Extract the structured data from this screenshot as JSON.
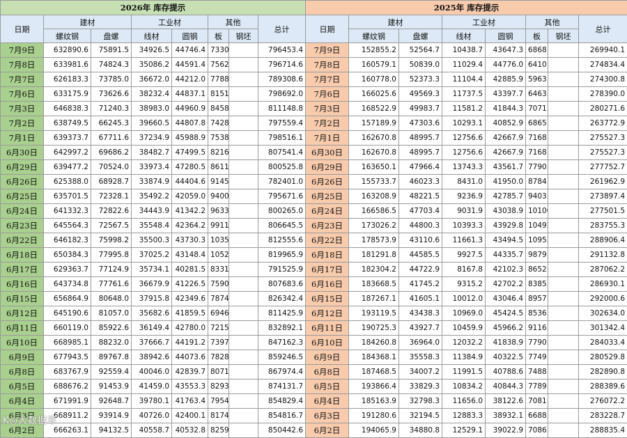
{
  "left": {
    "title": "2026年 库存提示",
    "headers": {
      "date": "日期",
      "jiancai": "建材",
      "gongyecai": "工业材",
      "qita": "其他",
      "total": "总计",
      "subs": [
        "螺纹钢",
        "盘螺",
        "线材",
        "圆钢",
        "板",
        "钢坯"
      ]
    },
    "rows": [
      [
        "7月9日",
        "632890.6",
        "75891.5",
        "34926.5",
        "44746.4",
        "7330.2",
        "",
        "796453.4"
      ],
      [
        "7月8日",
        "633981.6",
        "74824.3",
        "35086.2",
        "44591.4",
        "7562.8",
        "",
        "796714.6"
      ],
      [
        "7月7日",
        "626183.3",
        "73785.0",
        "36672.0",
        "44212.0",
        "7788.1",
        "",
        "789308.6"
      ],
      [
        "7月6日",
        "633175.9",
        "73626.6",
        "38232.4",
        "44837.1",
        "8151.7",
        "",
        "798692.0"
      ],
      [
        "7月3日",
        "646838.3",
        "71240.3",
        "38983.0",
        "44960.9",
        "8458.1",
        "",
        "811148.8"
      ],
      [
        "7月2日",
        "638749.5",
        "66245.3",
        "39660.5",
        "44807.8",
        "7428.0",
        "",
        "797559.4"
      ],
      [
        "7月1日",
        "639373.7",
        "67711.6",
        "37234.9",
        "45988.9",
        "7538.8",
        "",
        "798516.1"
      ],
      [
        "6月30日",
        "642997.2",
        "69686.2",
        "38482.7",
        "47499.5",
        "8216.6",
        "",
        "807541.4"
      ],
      [
        "6月29日",
        "639477.2",
        "70524.0",
        "33973.4",
        "47280.5",
        "8611.5",
        "",
        "800525.8"
      ],
      [
        "6月26日",
        "625388.0",
        "68928.7",
        "33874.9",
        "44404.6",
        "9145.6",
        "",
        "782401.0"
      ],
      [
        "6月25日",
        "635701.5",
        "72328.1",
        "35492.2",
        "42059.0",
        "9400.8",
        "",
        "795671.6"
      ],
      [
        "6月24日",
        "641332.3",
        "72822.6",
        "34443.9",
        "41342.2",
        "9633.9",
        "",
        "800265.0"
      ],
      [
        "6月23日",
        "645564.3",
        "72567.5",
        "35548.4",
        "42364.2",
        "9911.1",
        "",
        "806645.5"
      ],
      [
        "6月22日",
        "646182.3",
        "75998.2",
        "35500.3",
        "43730.3",
        "10354.4",
        "",
        "812555.6"
      ],
      [
        "6月18日",
        "650384.3",
        "77995.8",
        "37025.2",
        "43148.4",
        "10525.8",
        "",
        "819965.9"
      ],
      [
        "6月17日",
        "629363.7",
        "77124.9",
        "35734.1",
        "40281.5",
        "8331.6",
        "",
        "791525.9"
      ],
      [
        "6月16日",
        "643734.8",
        "77761.6",
        "36679.9",
        "41226.5",
        "7590.8",
        "",
        "807683.6"
      ],
      [
        "6月15日",
        "656864.9",
        "80648.0",
        "37915.8",
        "42349.6",
        "7874.0",
        "",
        "826342.4"
      ],
      [
        "6月12日",
        "645190.6",
        "81057.0",
        "35682.6",
        "41859.5",
        "6946.1",
        "",
        "811425.9"
      ],
      [
        "6月11日",
        "660119.0",
        "85922.6",
        "36149.4",
        "42780.0",
        "7215.0",
        "",
        "832892.1"
      ],
      [
        "6月10日",
        "668985.1",
        "88232.0",
        "37666.7",
        "44191.2",
        "7397.3",
        "",
        "847162.3"
      ],
      [
        "6月9日",
        "677943.5",
        "89767.8",
        "38942.6",
        "44073.6",
        "7828.9",
        "",
        "859246.5"
      ],
      [
        "6月8日",
        "683767.9",
        "92559.4",
        "40046.0",
        "42839.7",
        "8071.3",
        "",
        "867974.4"
      ],
      [
        "6月5日",
        "688676.2",
        "91453.9",
        "41459.0",
        "43553.3",
        "8293.1",
        "",
        "874131.7"
      ],
      [
        "6月4日",
        "671991.9",
        "92648.7",
        "39780.1",
        "41763.4",
        "7954.9",
        "",
        "854829.4"
      ],
      [
        "6月3日",
        "668911.2",
        "93914.9",
        "40726.0",
        "42400.1",
        "8174.5",
        "",
        "854816.7"
      ],
      [
        "6月2日",
        "666263.1",
        "94132.5",
        "40558.7",
        "40532.8",
        "8259.4",
        "",
        "850442.6"
      ]
    ]
  },
  "right": {
    "title": "2025年 库存提示",
    "headers": {
      "date": "日期",
      "jiancai": "建材",
      "gongyecai": "工业材",
      "qita": "其他",
      "total": "总计",
      "subs": [
        "螺纹钢",
        "盘螺",
        "线材",
        "圆钢",
        "板",
        "钢坯"
      ]
    },
    "rows": [
      [
        "7月9日",
        "152855.2",
        "52564.7",
        "10438.7",
        "43647.3",
        "6868.3",
        "",
        "269940.1"
      ],
      [
        "7月8日",
        "160579.1",
        "50839.0",
        "11029.4",
        "44776.0",
        "6410.5",
        "",
        "274834.4"
      ],
      [
        "7月7日",
        "160778.0",
        "52373.3",
        "11104.4",
        "42885.9",
        "5963.2",
        "",
        "274300.8"
      ],
      [
        "7月6日",
        "166025.6",
        "49569.3",
        "11737.5",
        "43397.7",
        "6463.8",
        "",
        "278390.0"
      ],
      [
        "7月3日",
        "168522.9",
        "49983.7",
        "11581.2",
        "41844.3",
        "7071.4",
        "",
        "280271.6"
      ],
      [
        "7月2日",
        "157189.9",
        "47303.6",
        "10293.1",
        "40852.9",
        "6865.2",
        "",
        "263772.9"
      ],
      [
        "7月1日",
        "162670.8",
        "48995.7",
        "12756.6",
        "42667.9",
        "7168.2",
        "",
        "275527.3"
      ],
      [
        "6月30日",
        "162670.8",
        "48995.7",
        "12756.6",
        "42667.9",
        "7168.2",
        "",
        "275527.3"
      ],
      [
        "6月29日",
        "163650.1",
        "47966.4",
        "13743.3",
        "43561.7",
        "7790.3",
        "",
        "277752.7"
      ],
      [
        "6月26日",
        "155733.7",
        "46023.3",
        "8431.0",
        "41950.0",
        "8784.1",
        "",
        "261962.9"
      ],
      [
        "6月25日",
        "163208.9",
        "48221.5",
        "9236.9",
        "42785.7",
        "9403.7",
        "",
        "273897.4"
      ],
      [
        "6月24日",
        "166586.5",
        "47703.4",
        "9031.9",
        "43038.9",
        "10100.0",
        "",
        "277501.5"
      ],
      [
        "6月23日",
        "173026.2",
        "44800.3",
        "10393.3",
        "43929.8",
        "10492.7",
        "",
        "283755.3"
      ],
      [
        "6月22日",
        "178573.9",
        "43110.6",
        "11661.3",
        "43494.5",
        "10953.0",
        "",
        "288906.4"
      ],
      [
        "6月18日",
        "181291.8",
        "44585.5",
        "9927.5",
        "44335.7",
        "9879.3",
        "",
        "291132.8"
      ],
      [
        "6月17日",
        "182304.2",
        "44722.9",
        "8167.8",
        "42102.3",
        "8652.1",
        "",
        "287062.2"
      ],
      [
        "6月16日",
        "183668.5",
        "41745.2",
        "9315.2",
        "42702.2",
        "8385.9",
        "",
        "286930.1"
      ],
      [
        "6月15日",
        "187267.1",
        "41605.1",
        "10012.0",
        "43046.4",
        "8957.1",
        "",
        "292000.6"
      ],
      [
        "6月12日",
        "193119.5",
        "43438.3",
        "10969.0",
        "45424.5",
        "8536.1",
        "",
        "302634.0"
      ],
      [
        "6月11日",
        "190725.3",
        "43927.7",
        "10459.9",
        "45966.2",
        "9116.8",
        "",
        "301342.4"
      ],
      [
        "6月10日",
        "184260.8",
        "36964.0",
        "12032.2",
        "41838.9",
        "7790.9",
        "",
        "284033.4"
      ],
      [
        "6月9日",
        "184368.1",
        "35558.3",
        "11384.9",
        "40322.5",
        "7749.4",
        "",
        "280529.8"
      ],
      [
        "6月8日",
        "187468.5",
        "34007.2",
        "11991.5",
        "40788.6",
        "7488.4",
        "",
        "282890.8"
      ],
      [
        "6月5日",
        "193866.4",
        "33829.3",
        "10834.2",
        "40844.3",
        "7789.3",
        "",
        "288389.6"
      ],
      [
        "6月4日",
        "185163.9",
        "32798.3",
        "11656.0",
        "38122.6",
        "7081.4",
        "",
        "276072.2"
      ],
      [
        "6月3日",
        "191280.6",
        "32194.5",
        "12883.3",
        "38932.1",
        "6688.2",
        "",
        "283228.7"
      ],
      [
        "6月2日",
        "194065.9",
        "34880.8",
        "12529.1",
        "39022.9",
        "7086.6",
        "",
        "288835.4"
      ]
    ]
  },
  "watermark": "K◎大数据导"
}
